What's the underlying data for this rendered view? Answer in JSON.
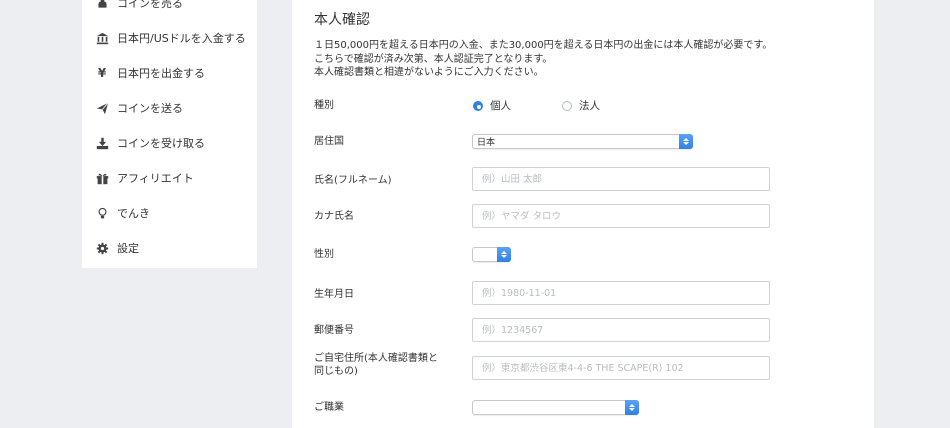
{
  "sidebar": {
    "items": [
      {
        "label": "コインを売る",
        "icon": "coin-sell-icon"
      },
      {
        "label": "日本円/USドルを入金する",
        "icon": "bank-icon"
      },
      {
        "label": "日本円を出金する",
        "icon": "yen-icon",
        "glyph": "¥"
      },
      {
        "label": "コインを送る",
        "icon": "send-icon"
      },
      {
        "label": "コインを受け取る",
        "icon": "download-icon"
      },
      {
        "label": "アフィリエイト",
        "icon": "gift-icon"
      },
      {
        "label": "でんき",
        "icon": "lightbulb-icon"
      },
      {
        "label": "設定",
        "icon": "gear-icon"
      }
    ]
  },
  "form": {
    "title": "本人確認",
    "description": [
      "１日50,000円を超える日本円の入金、また30,000円を超える日本円の出金には本人確認が必要です。",
      "こちらで確認が済み次第、本人認証完了となります。",
      "本人確認書類と相違がないようにご入力ください。"
    ],
    "type_label": "種別",
    "type_options": [
      "個人",
      "法人"
    ],
    "type_selected": "個人",
    "country_label": "居住国",
    "country_value": "日本",
    "name_label": "氏名(フルネーム)",
    "name_placeholder": "例）山田 太郎",
    "kana_label": "カナ氏名",
    "kana_placeholder": "例）ヤマダ タロウ",
    "gender_label": "性別",
    "gender_value": "",
    "birth_label": "生年月日",
    "birth_placeholder": "例）1980-11-01",
    "postal_label": "郵便番号",
    "postal_placeholder": "例）1234567",
    "address_label_line1": "ご自宅住所(本人確認書類と",
    "address_label_line2": "同じもの)",
    "address_placeholder": "例）東京都渋谷区東4-4-6 THE SCAPE(R) 102",
    "job_label": "ご職業",
    "job_value": ""
  },
  "colors": {
    "accent": "#2f7fe6",
    "background": "#eceef1",
    "panel": "#ffffff"
  }
}
